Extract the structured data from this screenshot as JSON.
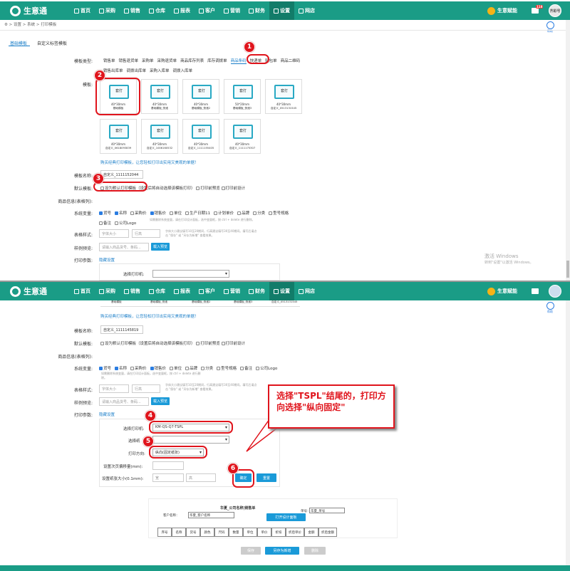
{
  "app": {
    "name": "生意通"
  },
  "nav": {
    "items": [
      "首页",
      "采购",
      "销售",
      "仓库",
      "报表",
      "客户",
      "营销",
      "财务",
      "设置",
      "网店"
    ],
    "active": "设置",
    "yinyi": "生意赋能",
    "msg_badge": "118",
    "avatar": "齐彩号"
  },
  "help": "帮助",
  "breadcrumb": [
    "设置",
    "系统",
    "打印模板"
  ],
  "tabs": [
    "基础模板",
    "自定义标签模板"
  ],
  "form": {
    "type_label": "模板类型:",
    "types_row1": [
      "销售单",
      "销售退货单",
      "采购单",
      "采购退货单",
      "商品库存列表",
      "库存调拨单",
      "商品条码",
      "快递单",
      "贴包单",
      "商品二维码"
    ],
    "types_row2": [
      "销售出库单",
      "调拨出库单",
      "采购入库单",
      "调拨入库单"
    ],
    "active_type": "商品条码",
    "template_label": "模板:",
    "templates": [
      {
        "sz": "40*30mm",
        "nm": "基础模板"
      },
      {
        "sz": "40*30mm",
        "nm": "基础模板_快递"
      },
      {
        "sz": "40*30mm",
        "nm": "基础模板_快递2"
      },
      {
        "sz": "50*20mm",
        "nm": "基础模板_快递3"
      },
      {
        "sz": "40*30mm",
        "nm": "自定义_0513131545"
      },
      {
        "sz": "40*30mm",
        "nm": "自定义_0618093839"
      },
      {
        "sz": "40*30mm",
        "nm": "自定义_1006160532"
      },
      {
        "sz": "40*30mm",
        "nm": "自定义_1111155405"
      },
      {
        "sz": "40*30mm",
        "nm": "自定义_1111175307"
      }
    ],
    "tpl_btn": "套打",
    "buy_link": "购买经典打印模板，让您轻松打印出实用又美观的单据！",
    "name_label": "模板名称:",
    "name_value": "自定义_1111152044",
    "default_label": "默认模板:",
    "default_opts": [
      "设为默认打印模板（设置后将自动选择该模板打印）",
      "打印前预览",
      "打印前设计"
    ],
    "goods_label": "商品信息(表格列):",
    "vars_label": "系统变量:",
    "vars_row1": [
      {
        "t": "货号",
        "on": true
      },
      {
        "t": "名称",
        "on": true
      },
      {
        "t": "采购价",
        "on": false
      },
      {
        "t": "销售价",
        "on": true
      },
      {
        "t": "单位",
        "on": false
      },
      {
        "t": "生产日期11",
        "on": false
      },
      {
        "t": "计划单价",
        "on": false
      },
      {
        "t": "品牌",
        "on": false
      },
      {
        "t": "分类",
        "on": false
      },
      {
        "t": "型号规格",
        "on": false
      }
    ],
    "vars_row2": [
      {
        "t": "备注",
        "on": false
      },
      {
        "t": "公司Logo",
        "on": false
      }
    ],
    "vars_hint": "如需删除系统变量，请在打印设计面板，选中变量框，按 ctrl + delete 进行删除。",
    "style_label": "表格样式:",
    "font_ph": "字体大小",
    "row_ph": "行高",
    "style_hint": "字体大小建议填写10至20期间，行高建议填写30至40期间。填写后请点击 \"保存\" 或 \"另存为新增\" 查看效果。",
    "preview_label": "样例预览:",
    "preview_ph": "请输入商品货号、条码...",
    "preview_btn": "载入预览",
    "param_label": "打印参数:",
    "hide_link": "隐藏设置",
    "printer_label": "选择打印机:"
  },
  "form2": {
    "name_value": "自定义_1111145819",
    "default_opts": [
      "设为默认打印模板（设置后将自动选择该模板打印）",
      "打印前预览",
      "打印前设计"
    ],
    "vars_row1": [
      {
        "t": "货号",
        "on": true
      },
      {
        "t": "名称",
        "on": true
      },
      {
        "t": "采购价",
        "on": false
      },
      {
        "t": "销售价",
        "on": true
      },
      {
        "t": "单位",
        "on": false
      },
      {
        "t": "品牌",
        "on": false
      },
      {
        "t": "分类",
        "on": false
      },
      {
        "t": "型号规格",
        "on": false
      },
      {
        "t": "备注",
        "on": false
      },
      {
        "t": "公司Logo",
        "on": false
      }
    ],
    "printer_value": "KM-QS-Q7-TSPL",
    "paper_label": "选择纸",
    "dir_label": "打印方向:",
    "dir_value": "纵向(固定纸张)",
    "offset_label": "设置次页偏移量(mm):",
    "paper_size_label": "设置纸张大小(0.1mm):",
    "w_ph": "宽",
    "h_ph": "高",
    "ok_btn": "确定",
    "reset_btn": "重置",
    "design_btn": "打开设计面板",
    "sample_title": "华夏_公司名称|销售单",
    "sample_cust": "客户名称：",
    "sample_cust_v": "华夏_客户名称",
    "sample_no": "单号：",
    "sample_no_v": "华夏_单号",
    "cols": [
      "序号",
      "名称",
      "货号",
      "颜色",
      "尺码",
      "数量",
      "单位",
      "单价",
      "折扣",
      "折后单价",
      "金额",
      "折后金额"
    ],
    "save_btn": "保存",
    "saveas_btn": "另存为新增",
    "delete_btn": "删除"
  },
  "callout": "选择\"TSPL\"结尾的，打印方向选择\"纵向固定\"",
  "watermark": {
    "line1": "激活 Windows",
    "line2": "转到\"设置\"以激活 Windows。"
  },
  "steps": [
    "1",
    "2",
    "3",
    "4",
    "5",
    "6"
  ]
}
